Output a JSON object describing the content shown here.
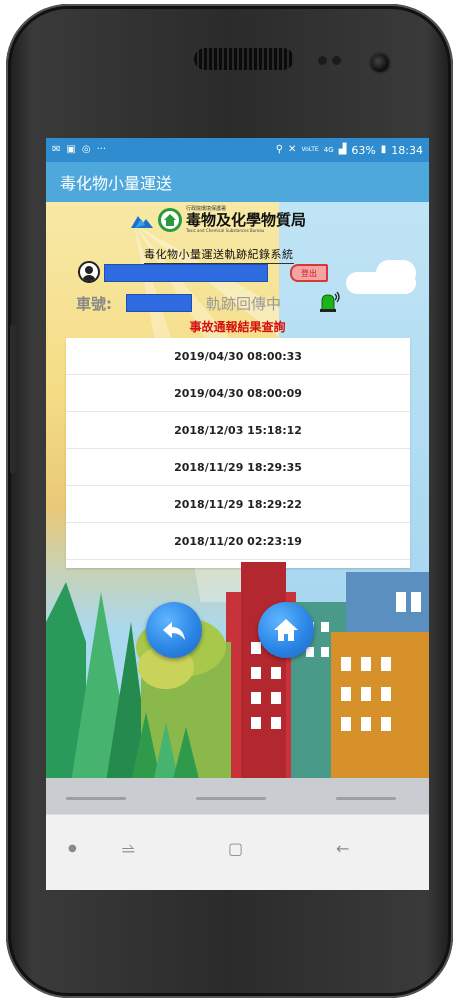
{
  "status_bar": {
    "left_icons": [
      "notification-icon",
      "image-icon",
      "messenger-icon",
      "more-icon"
    ],
    "right_icons": [
      "location-icon",
      "mute-icon",
      "volte-icon",
      "4g-icon",
      "signal-icon",
      "battery-icon"
    ],
    "volte_label": "Vo))\nLTE",
    "network_label": "4G",
    "battery": "63%",
    "time": "18:34"
  },
  "app_bar": {
    "title": "毒化物小量運送"
  },
  "header": {
    "org_line_small": "行政院環境保護署",
    "bureau_name": "毒物及化學物質局",
    "org_line_en": "Toxic and Chemical Substances Bureau",
    "system_title": "毒化物小量運送軌跡紀錄系統"
  },
  "user": {
    "logout_label": "登出"
  },
  "vehicle": {
    "plate_label": "車號:",
    "tracking_status": "軌跡回傳中"
  },
  "section_heading": "事故通報結果查詢",
  "records": [
    "2019/04/30 08:00:33",
    "2019/04/30 08:00:09",
    "2018/12/03 15:18:12",
    "2018/11/29 18:29:35",
    "2018/11/29 18:29:22",
    "2018/11/20 02:23:19"
  ],
  "actions": {
    "back_icon": "reply-arrow-icon",
    "home_icon": "home-icon"
  },
  "nav": {
    "icons": [
      "dot-icon",
      "recent-apps-icon",
      "home-square-icon",
      "back-arrow-icon"
    ]
  },
  "colors": {
    "status_bar": "#2e8ccf",
    "app_bar": "#4fa8dc",
    "heading": "#d41010",
    "button": "#2b86e6"
  }
}
